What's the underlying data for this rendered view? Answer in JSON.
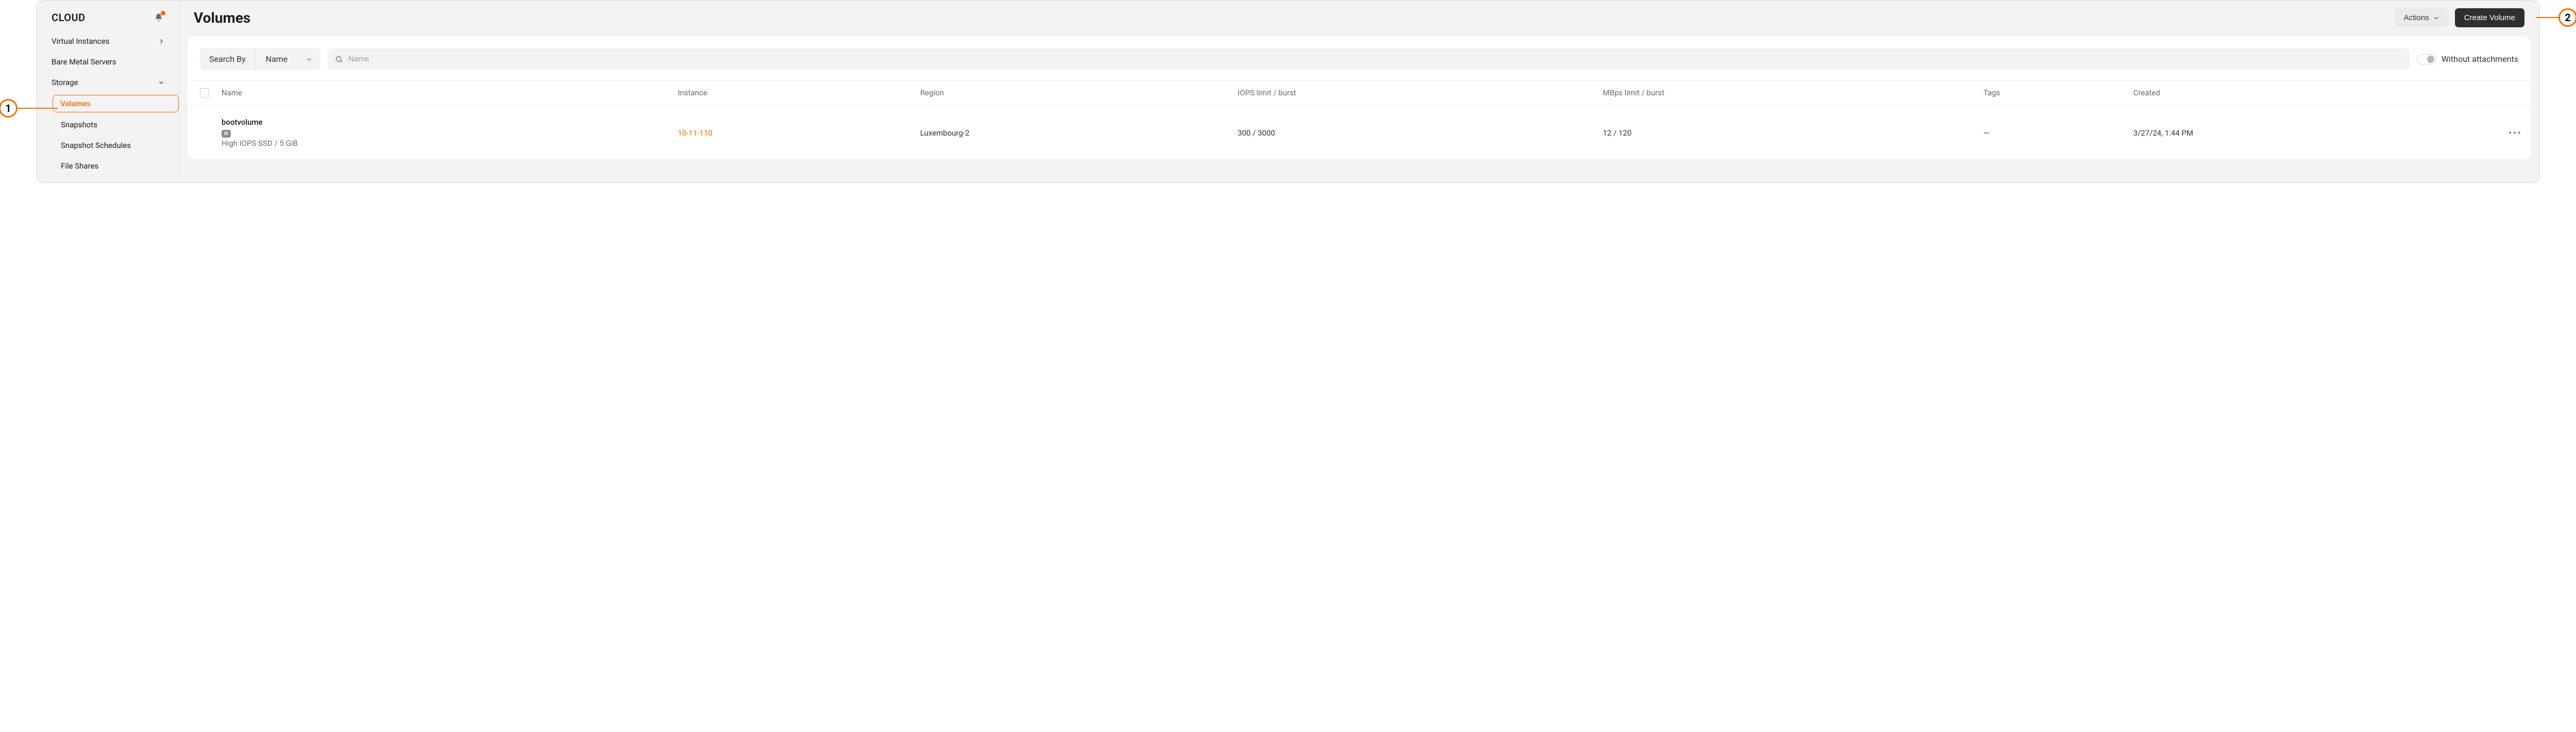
{
  "sidebar": {
    "brand": "CLOUD",
    "items": [
      {
        "label": "Virtual Instances",
        "chevron": "right"
      },
      {
        "label": "Bare Metal Servers"
      },
      {
        "label": "Storage",
        "chevron": "down"
      }
    ],
    "storage_children": [
      {
        "label": "Volumes",
        "active": true
      },
      {
        "label": "Snapshots"
      },
      {
        "label": "Snapshot Schedules"
      },
      {
        "label": "File Shares"
      }
    ]
  },
  "header": {
    "title": "Volumes",
    "actions_label": "Actions",
    "create_label": "Create Volume"
  },
  "filters": {
    "search_by_label": "Search By",
    "search_by_value": "Name",
    "search_placeholder": "Name",
    "toggle_label": "Without attachments"
  },
  "table": {
    "columns": {
      "name": "Name",
      "instance": "Instance",
      "region": "Region",
      "iops": "IOPS limit / burst",
      "mbps": "MBps limit / burst",
      "tags": "Tags",
      "created": "Created"
    },
    "rows": [
      {
        "name": "bootvolume",
        "id_badge": "ID",
        "spec": "High IOPS SSD / 5 GiB",
        "instance": "10-11-110",
        "region": "Luxembourg-2",
        "iops": "300 / 3000",
        "mbps": "12 / 120",
        "tags": "—",
        "created": "3/27/24, 1:44 PM"
      }
    ]
  },
  "annotations": {
    "one": "1",
    "two": "2"
  },
  "colors": {
    "accent": "#ff6b00",
    "primary_btn": "#2f2f2f"
  }
}
